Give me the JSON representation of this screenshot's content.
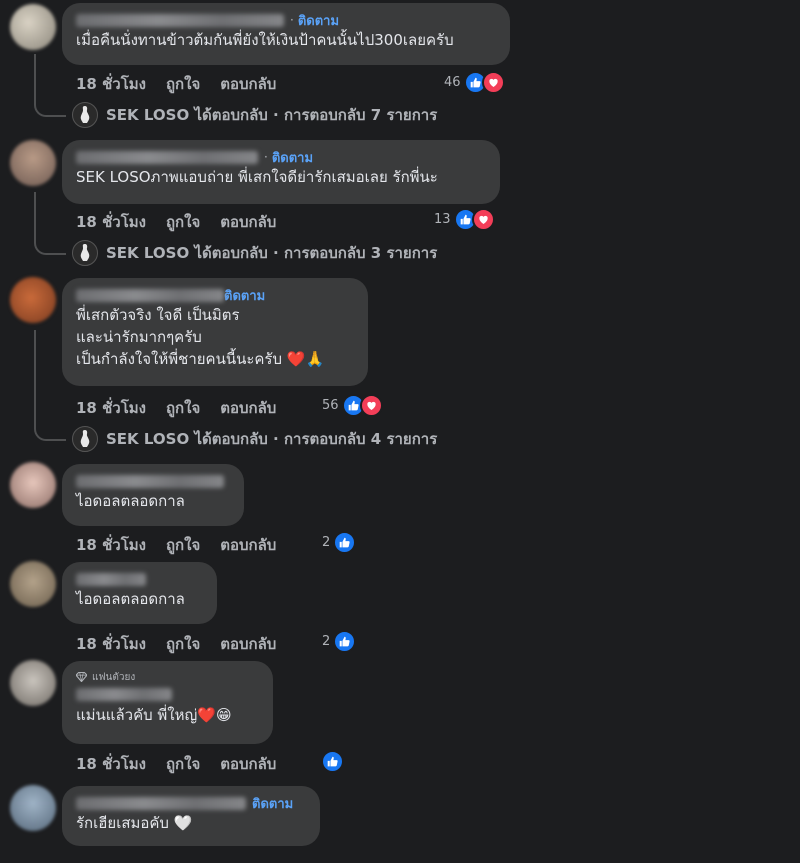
{
  "labels": {
    "time": "18 ชั่วโมง",
    "like": "ถูกใจ",
    "reply": "ตอบกลับ",
    "follow": "ติดตาม",
    "sep": "·"
  },
  "comments": [
    {
      "text": "เมื่อคืนนั่งทานข้าวต้มกันพี่ยังให้เงินป้าคนนั้นไป300เลยครับ",
      "reaction_count": "46",
      "reply_summary": "SEK LOSO ได้ตอบกลับ · การตอบกลับ 7 รายการ"
    },
    {
      "text": "SEK LOSOภาพแอบถ่าย  พี่เสกใจดีย่ารักเสมอเลย รักพี่นะ",
      "reaction_count": "13",
      "reply_summary": "SEK LOSO ได้ตอบกลับ · การตอบกลับ 3 รายการ"
    },
    {
      "text": "พี่เสกตัวจริง ใจดี เป็นมิตร\nและน่ารักมากๆครับ\nเป็นกำลังใจให้พี่ชายคนนี้นะครับ ❤️🙏",
      "reaction_count": "56",
      "reply_summary": "SEK LOSO ได้ตอบกลับ · การตอบกลับ 4 รายการ"
    },
    {
      "text": "ไอดอลตลอดกาล",
      "reaction_count": "2"
    },
    {
      "text": "ไอดอลตลอดกาล",
      "reaction_count": "2"
    },
    {
      "badge": "แฟนตัวยง",
      "text": "แม่นแล้วคับ พี่ใหญ่❤️😁",
      "reaction_count": ""
    },
    {
      "text": "รักเฮียเสมอคับ 🤍"
    }
  ],
  "colors": {
    "background": "#1c1d1f",
    "bubble": "#3a3b3c",
    "follow_link": "#5aa2f7",
    "like_blue": "#1877f2",
    "love_red": "#f33e58"
  }
}
